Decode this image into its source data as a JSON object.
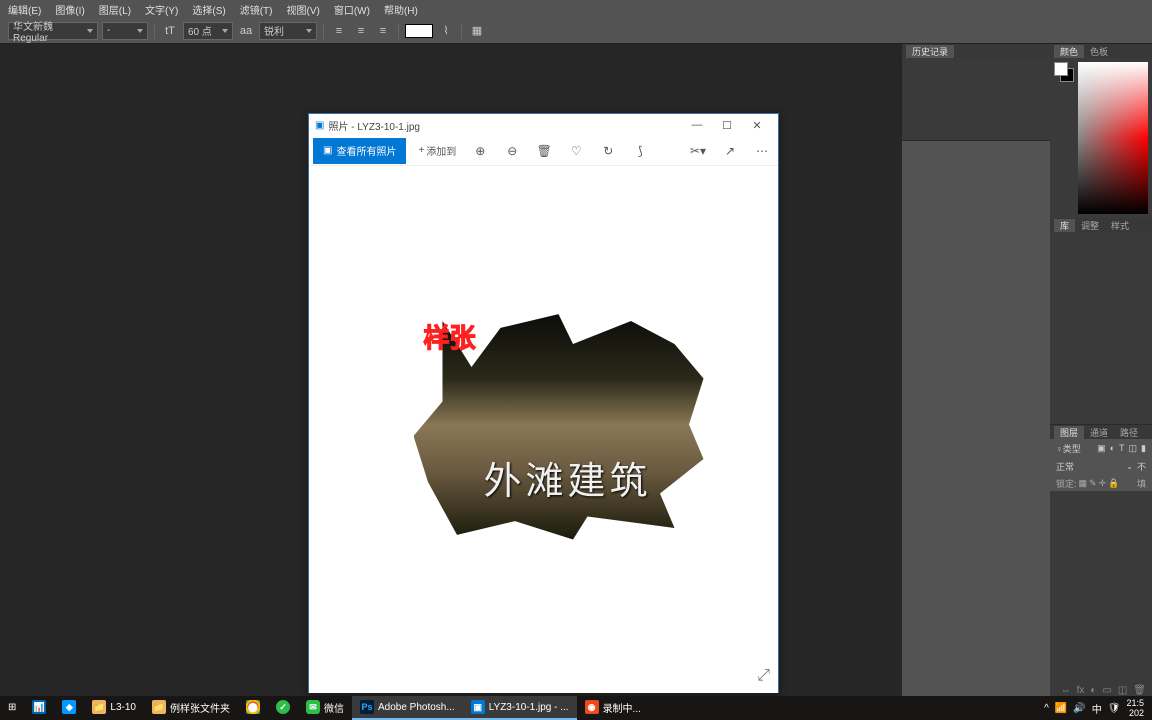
{
  "menu": [
    "编辑(E)",
    "图像(I)",
    "图层(L)",
    "文字(Y)",
    "选择(S)",
    "滤镜(T)",
    "视图(V)",
    "窗口(W)",
    "帮助(H)"
  ],
  "options": {
    "font_family": "华文新魏 Regular",
    "font_style": "-",
    "font_size": "60 点",
    "anti_alias_label": "aa",
    "anti_alias": "锐利"
  },
  "photo_window": {
    "title_prefix": "照片 - ",
    "file_name": "LYZ3-10-1.jpg",
    "btn_view_all": "查看所有照片",
    "btn_add": "添加到"
  },
  "artwork": {
    "neon": "样张",
    "calligraphy": "外滩建筑"
  },
  "panels": {
    "history": {
      "tab": "历史记录"
    },
    "color": {
      "tabs": [
        "颜色",
        "色板"
      ]
    },
    "library": {
      "tabs": [
        "库",
        "调整",
        "样式"
      ]
    },
    "layers": {
      "tabs": [
        "图层",
        "通道",
        "路径"
      ],
      "filter_label": "♀类型",
      "blend_mode": "正常",
      "opacity_label": "不",
      "lock_label": "锁定:",
      "fill_label": "填"
    }
  },
  "taskbar": {
    "items": [
      {
        "label": "L3-10",
        "icon_bg": "#efb55a"
      },
      {
        "label": "例样张文件夹",
        "icon_bg": "#efb55a"
      },
      {
        "label": "",
        "icon_bg": "#fff",
        "chrome": true
      },
      {
        "label": "",
        "icon_bg": "#2dbd4a"
      },
      {
        "label": "微信",
        "icon_bg": "#2dbd4a"
      },
      {
        "label": "Adobe Photosh...",
        "icon_bg": "#001e36",
        "active": true
      },
      {
        "label": "LYZ3-10-1.jpg - ...",
        "icon_bg": "#0078d4"
      },
      {
        "label": "录制中...",
        "icon_bg": "#e84c1a"
      }
    ],
    "time": "21:5",
    "date": "202"
  }
}
